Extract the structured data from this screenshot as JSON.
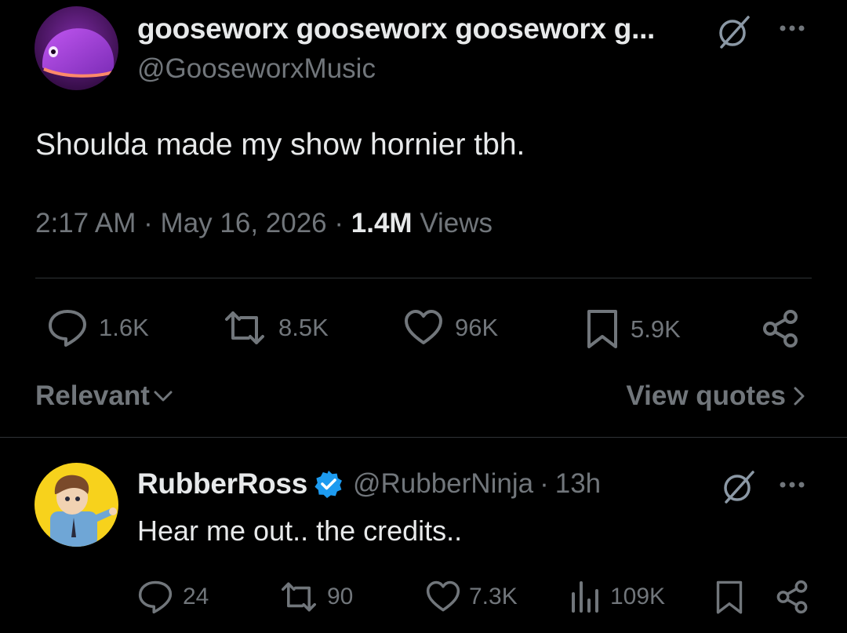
{
  "tweet": {
    "author_name": "gooseworx gooseworx gooseworx g...",
    "author_handle": "@GooseworxMusic",
    "text": "Shoulda made my show hornier tbh.",
    "time": "2:17 AM",
    "sep1": "·",
    "date": "May 16, 2026",
    "sep2": "·",
    "views_count": "1.4M",
    "views_label": "Views",
    "actions": {
      "replies": "1.6K",
      "reposts": "8.5K",
      "likes": "96K",
      "bookmarks": "5.9K"
    }
  },
  "sort": {
    "label": "Relevant",
    "quotes_link": "View quotes"
  },
  "reply": {
    "author_name": "RubberRoss",
    "author_handle": "@RubberNinja",
    "sep": "·",
    "time_ago": "13h",
    "text": "Hear me out.. the credits..",
    "actions": {
      "replies": "24",
      "reposts": "90",
      "likes": "7.3K",
      "views": "109K"
    }
  },
  "colors": {
    "background": "#000000",
    "text": "#e7e9ea",
    "muted": "#71767b",
    "divider": "#2f3336",
    "verified": "#1d9bf0"
  },
  "icons": [
    "grok-icon",
    "more-icon",
    "reply-icon",
    "repost-icon",
    "like-icon",
    "bookmark-icon",
    "share-icon",
    "chevron-down-icon",
    "chevron-right-icon",
    "verified-badge-icon",
    "views-icon"
  ]
}
